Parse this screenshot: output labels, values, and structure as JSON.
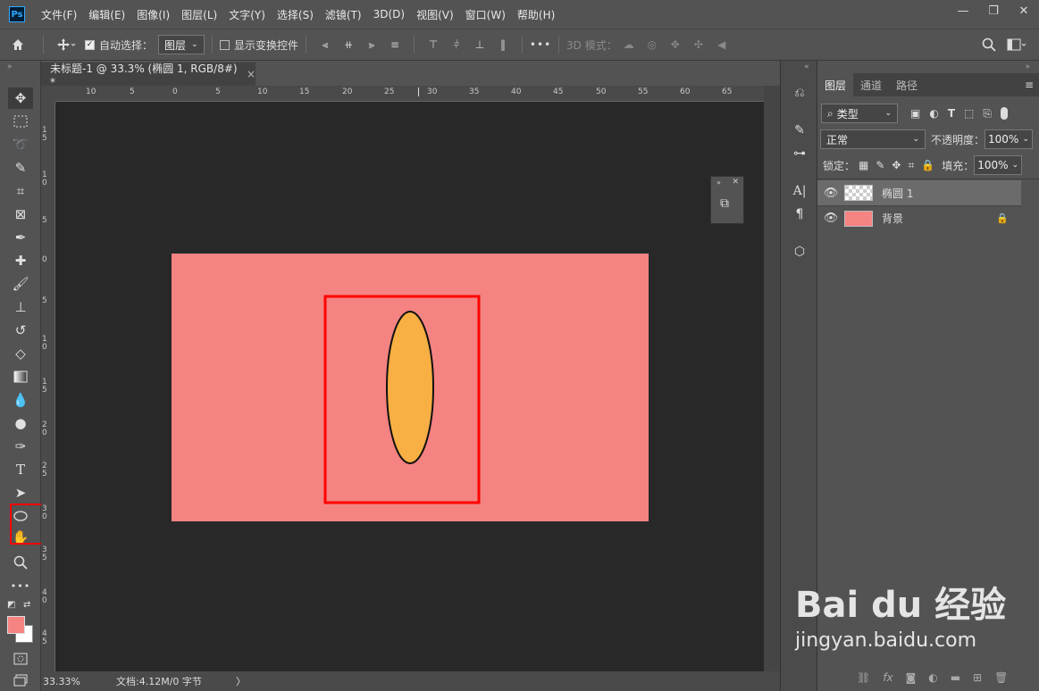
{
  "app": {
    "logo": "Ps"
  },
  "menu": [
    "文件(F)",
    "编辑(E)",
    "图像(I)",
    "图层(L)",
    "文字(Y)",
    "选择(S)",
    "滤镜(T)",
    "3D(D)",
    "视图(V)",
    "窗口(W)",
    "帮助(H)"
  ],
  "window_controls": {
    "minimize": "—",
    "restore": "❐",
    "close": "✕"
  },
  "options": {
    "auto_select_label": "自动选择：",
    "auto_select_value": "图层",
    "show_transform_label": "显示变换控件",
    "more": "•••",
    "mode_3d_label": "3D 模式："
  },
  "document": {
    "tab_title": "未标题-1 @ 33.3% (椭圆 1, RGB/8#) *",
    "tab_close": "×",
    "zoom": "33.33%",
    "doc_info": "文档:4.12M/0 字节",
    "arrow": "〉"
  },
  "ruler_h": [
    "10",
    "5",
    "0",
    "5",
    "10",
    "15",
    "20",
    "25",
    "30",
    "35",
    "40",
    "45",
    "50",
    "55",
    "60",
    "65"
  ],
  "ruler_v": [
    "1 5",
    "1 0",
    "5",
    "0",
    "5",
    "1 0",
    "1 5",
    "2 0",
    "2 5",
    "3 0",
    "3 5",
    "4 0",
    "4 5"
  ],
  "canvas": {
    "background_color": "#f48382",
    "ellipse_fill": "#f8af43",
    "highlight_color": "#ff0000"
  },
  "panels": {
    "tabs": [
      "图层",
      "通道",
      "路径"
    ],
    "filter_label": "类型",
    "blend_mode": "正常",
    "opacity_label": "不透明度：",
    "opacity_value": "100%",
    "lock_label": "锁定：",
    "fill_label": "填充：",
    "fill_value": "100%"
  },
  "layers": [
    {
      "name": "椭圆 1",
      "selected": true
    },
    {
      "name": "背景",
      "selected": false,
      "locked": true
    }
  ],
  "colors": {
    "foreground": "#f48382",
    "background": "#ffffff"
  },
  "watermark": {
    "brand": "Bai du 经验",
    "url": "jingyan.baidu.com"
  }
}
